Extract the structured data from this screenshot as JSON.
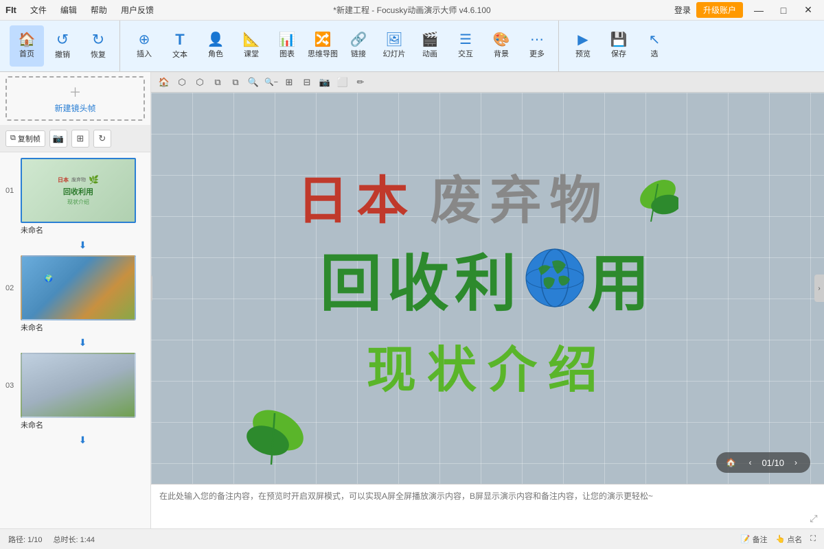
{
  "titleBar": {
    "logo": "FIt",
    "menu": [
      "文件",
      "编辑",
      "帮助",
      "用户反馈"
    ],
    "title": "*新建工程 - Focusky动画演示大师 v4.6.100",
    "loginLabel": "登录",
    "upgradeLabel": "升级账户",
    "windowControls": [
      "—",
      "□",
      "✕"
    ]
  },
  "toolbar": {
    "items": [
      {
        "id": "home",
        "icon": "🏠",
        "label": "首页"
      },
      {
        "id": "undo",
        "icon": "↺",
        "label": "撤销"
      },
      {
        "id": "redo",
        "icon": "↻",
        "label": "恢复"
      },
      {
        "id": "insert",
        "icon": "⊕",
        "label": "插入"
      },
      {
        "id": "text",
        "icon": "T",
        "label": "文本"
      },
      {
        "id": "role",
        "icon": "👤",
        "label": "角色"
      },
      {
        "id": "class",
        "icon": "📐",
        "label": "课堂"
      },
      {
        "id": "chart",
        "icon": "📊",
        "label": "图表"
      },
      {
        "id": "mindmap",
        "icon": "🔀",
        "label": "思维导图"
      },
      {
        "id": "link",
        "icon": "🔗",
        "label": "链接"
      },
      {
        "id": "ppt",
        "icon": "🖼",
        "label": "幻灯片"
      },
      {
        "id": "animate",
        "icon": "🎬",
        "label": "动画"
      },
      {
        "id": "interact",
        "icon": "☰",
        "label": "交互"
      },
      {
        "id": "bg",
        "icon": "🖼",
        "label": "背景"
      },
      {
        "id": "more",
        "icon": "⋯",
        "label": "更多"
      },
      {
        "id": "preview",
        "icon": "▶",
        "label": "预览"
      },
      {
        "id": "save",
        "icon": "💾",
        "label": "保存"
      },
      {
        "id": "select",
        "icon": "↖",
        "label": "选"
      }
    ]
  },
  "sidebar": {
    "newFrameLabel": "新建镜头帧",
    "copyBtn": "复制帧",
    "slides": [
      {
        "num": "01",
        "name": "未命名",
        "active": true
      },
      {
        "num": "02",
        "name": "未命名",
        "active": false
      },
      {
        "num": "03",
        "name": "未命名",
        "active": false
      }
    ]
  },
  "canvasTools": [
    "🏠",
    "⬡",
    "⬡",
    "⬡",
    "⬡",
    "🔍+",
    "🔍-",
    "⊞",
    "📐",
    "📷",
    "⬜",
    "✏"
  ],
  "slideContent": {
    "line1part1": "日本",
    "line1part2": "废弃物",
    "line2": "回收利",
    "line2suffix": "用",
    "line3": "现状介绍"
  },
  "playback": {
    "current": "01",
    "total": "10",
    "separator": "/"
  },
  "notes": {
    "placeholder": "在此处输入您的备注内容，在预览时开启双屏模式，可以实现A屏全屏播放演示内容，B屏显示演示内容和备注内容，让您的演示更轻松~"
  },
  "statusBar": {
    "path": "路径: 1/10",
    "duration": "总时长: 1:44",
    "notesBtn": "备注",
    "pointBtn": "点名"
  }
}
